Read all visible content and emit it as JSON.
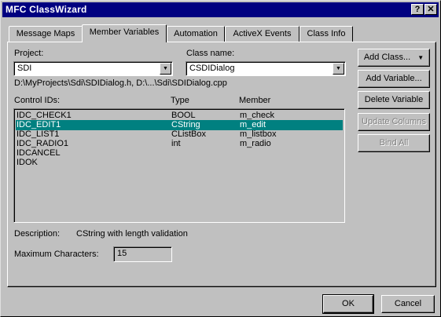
{
  "window": {
    "title": "MFC ClassWizard",
    "help_glyph": "?",
    "close_glyph": "✕"
  },
  "tabs": [
    {
      "label": "Message Maps"
    },
    {
      "label": "Member Variables"
    },
    {
      "label": "Automation"
    },
    {
      "label": "ActiveX Events"
    },
    {
      "label": "Class Info"
    }
  ],
  "active_tab": "Member Variables",
  "project": {
    "label": "Project:",
    "value": "SDI"
  },
  "class_name": {
    "label": "Class name:",
    "value": "CSDIDialog"
  },
  "file_path": "D:\\MyProjects\\Sdi\\SDIDialog.h, D:\\...\\Sdi\\SDIDialog.cpp",
  "list": {
    "headers": [
      "Control IDs:",
      "Type",
      "Member"
    ],
    "rows": [
      {
        "id": "IDC_CHECK1",
        "type": "BOOL",
        "member": "m_check"
      },
      {
        "id": "IDC_EDIT1",
        "type": "CString",
        "member": "m_edit"
      },
      {
        "id": "IDC_LIST1",
        "type": "CListBox",
        "member": "m_listbox"
      },
      {
        "id": "IDC_RADIO1",
        "type": "int",
        "member": "m_radio"
      },
      {
        "id": "IDCANCEL",
        "type": "",
        "member": ""
      },
      {
        "id": "IDOK",
        "type": "",
        "member": ""
      }
    ],
    "selected_index": 1
  },
  "description": {
    "label": "Description:",
    "value": "CString with length validation"
  },
  "max_chars": {
    "label": "Maximum Characters:",
    "value": "15"
  },
  "buttons": {
    "add_class": "Add Class...",
    "add_variable": "Add Variable...",
    "delete_variable": "Delete Variable",
    "update_columns": "Update Columns",
    "bind_all": "Bind All",
    "ok": "OK",
    "cancel": "Cancel"
  },
  "colors": {
    "title_bar": "#000080",
    "selection": "#008080",
    "face": "#c0c0c0"
  }
}
